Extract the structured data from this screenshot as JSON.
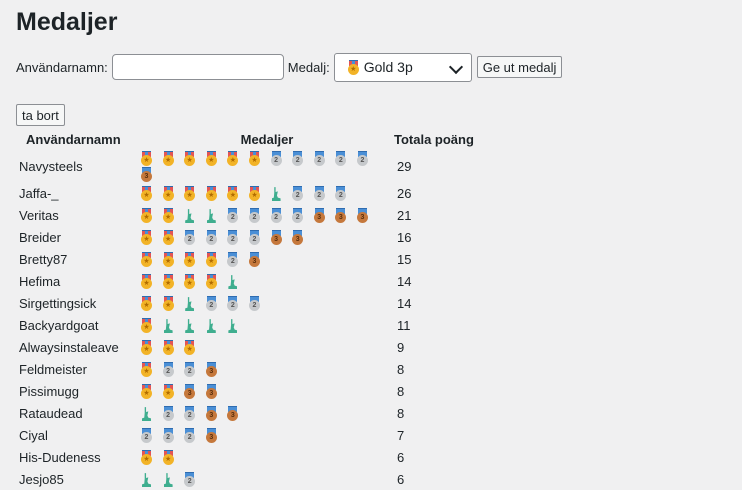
{
  "page": {
    "title": "Medaljer"
  },
  "form": {
    "username_label": "Användarnamn:",
    "username_value": "",
    "medal_label": "Medalj:",
    "medal_selected": "Gold 3p",
    "give_button": "Ge ut medalj",
    "remove_button": "ta bort"
  },
  "table": {
    "headers": {
      "user": "Användarnamn",
      "medals": "Medaljer",
      "points": "Totala poäng"
    },
    "rows": [
      {
        "name": "Navysteels",
        "medals": [
          "gold",
          "gold",
          "gold",
          "gold",
          "gold",
          "gold",
          "silver",
          "silver",
          "silver",
          "silver",
          "silver",
          "bronze"
        ],
        "points": "29"
      },
      {
        "name": "Jaffa-_",
        "medals": [
          "gold",
          "gold",
          "gold",
          "gold",
          "gold",
          "gold",
          "statue",
          "silver",
          "silver",
          "silver"
        ],
        "points": "26"
      },
      {
        "name": "Veritas",
        "medals": [
          "gold",
          "gold",
          "statue",
          "statue",
          "silver",
          "silver",
          "silver",
          "silver",
          "bronze",
          "bronze",
          "bronze"
        ],
        "points": "21"
      },
      {
        "name": "Breider",
        "medals": [
          "gold",
          "gold",
          "silver",
          "silver",
          "silver",
          "silver",
          "bronze",
          "bronze"
        ],
        "points": "16"
      },
      {
        "name": "Bretty87",
        "medals": [
          "gold",
          "gold",
          "gold",
          "gold",
          "silver",
          "bronze"
        ],
        "points": "15"
      },
      {
        "name": "Hefima",
        "medals": [
          "gold",
          "gold",
          "gold",
          "gold",
          "statue"
        ],
        "points": "14"
      },
      {
        "name": "Sirgettingsick",
        "medals": [
          "gold",
          "gold",
          "statue",
          "silver",
          "silver",
          "silver"
        ],
        "points": "14"
      },
      {
        "name": "Backyardgoat",
        "medals": [
          "gold",
          "statue",
          "statue",
          "statue",
          "statue"
        ],
        "points": "11"
      },
      {
        "name": "Alwaysinstaleave",
        "medals": [
          "gold",
          "gold",
          "gold"
        ],
        "points": "9"
      },
      {
        "name": "Feldmeister",
        "medals": [
          "gold",
          "silver",
          "silver",
          "bronze"
        ],
        "points": "8"
      },
      {
        "name": "Pissimugg",
        "medals": [
          "gold",
          "gold",
          "bronze",
          "bronze"
        ],
        "points": "8"
      },
      {
        "name": "Rataudead",
        "medals": [
          "statue",
          "silver",
          "silver",
          "bronze",
          "bronze"
        ],
        "points": "8"
      },
      {
        "name": "Ciyal",
        "medals": [
          "silver",
          "silver",
          "silver",
          "bronze"
        ],
        "points": "7"
      },
      {
        "name": "His-Dudeness",
        "medals": [
          "gold",
          "gold"
        ],
        "points": "6"
      },
      {
        "name": "Jesjo85",
        "medals": [
          "statue",
          "statue",
          "silver"
        ],
        "points": "6"
      }
    ]
  }
}
